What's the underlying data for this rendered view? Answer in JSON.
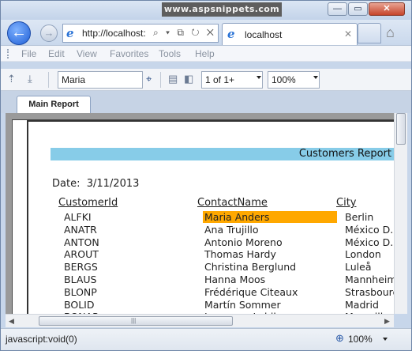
{
  "window": {
    "watermark": "www.aspsnippets.com",
    "min_glyph": "—",
    "max_glyph": "▭",
    "close_glyph": "✕"
  },
  "nav": {
    "url": "http://localhost:",
    "address_icons": "⌕ ▾ ⧉ ↻ ✕",
    "tab_title": "localhost",
    "tab_close": "✕"
  },
  "menu": [
    "File",
    "Edit",
    "View",
    "Favorites",
    "Tools",
    "Help"
  ],
  "report_toolbar": {
    "parameter_value": "Maria",
    "page_value": "1 of 1+",
    "zoom_value": "100%"
  },
  "report_tab": "Main Report",
  "report": {
    "title": "Customers Report",
    "date_label": "Date:",
    "date_value": "3/11/2013",
    "columns": [
      "CustomerId",
      "ContactName",
      "City"
    ],
    "rows": [
      [
        "ALFKI",
        "Maria Anders",
        "Berlin"
      ],
      [
        "ANATR",
        "Ana Trujillo",
        "México D.F."
      ],
      [
        "ANTON",
        "Antonio Moreno",
        "México D.F."
      ],
      [
        "AROUT",
        "Thomas Hardy",
        "London"
      ],
      [
        "BERGS",
        "Christina Berglund",
        "Luleå"
      ],
      [
        "BLAUS",
        "Hanna Moos",
        "Mannheim"
      ],
      [
        "BLONP",
        "Frédérique Citeaux",
        "Strasbourg"
      ],
      [
        "BOLID",
        "Martín Sommer",
        "Madrid"
      ],
      [
        "BONAP",
        "Laurence Lebihan",
        "Marseille"
      ]
    ],
    "selected_row": 0
  },
  "status": {
    "text": "javascript:void(0)",
    "zoom": "100%"
  }
}
